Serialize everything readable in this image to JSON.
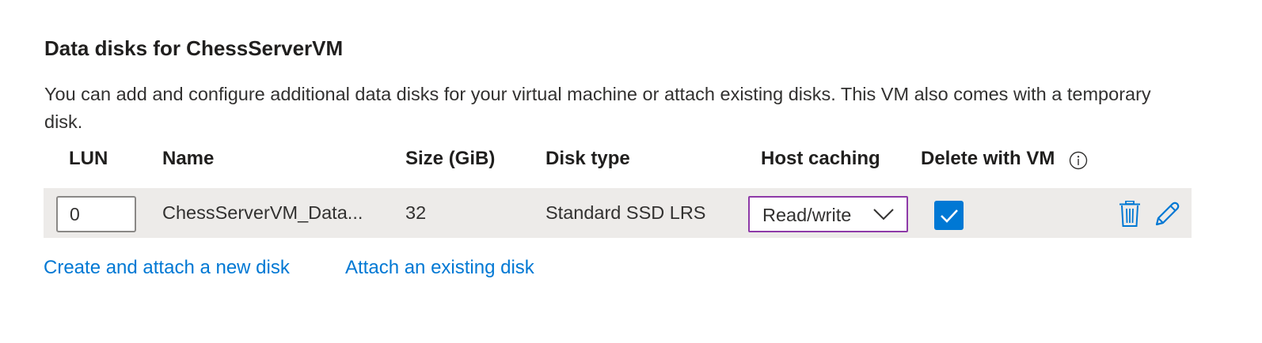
{
  "section": {
    "title": "Data disks for ChessServerVM",
    "description": "You can add and configure additional data disks for your virtual machine or attach existing disks. This VM also comes with a temporary disk."
  },
  "table": {
    "columns": {
      "lun": "LUN",
      "name": "Name",
      "size": "Size (GiB)",
      "disk_type": "Disk type",
      "host_caching": "Host caching",
      "delete_with_vm": "Delete with VM"
    },
    "rows": [
      {
        "lun": "0",
        "name": "ChessServerVM_Data...",
        "size": "32",
        "disk_type": "Standard SSD LRS",
        "host_caching": "Read/write",
        "delete_with_vm": true
      }
    ]
  },
  "links": {
    "create_new": "Create and attach a new disk",
    "attach_existing": "Attach an existing disk"
  },
  "icons": {
    "info": "info-icon",
    "chevron": "chevron-down-icon",
    "checkmark": "checkmark-icon",
    "delete": "trash-icon",
    "edit": "pencil-icon"
  },
  "colors": {
    "accent": "#0078d4",
    "row_background": "#edebe9",
    "select_focus_border": "#8e3aa8",
    "text": "#323130",
    "heading": "#201f1e"
  }
}
